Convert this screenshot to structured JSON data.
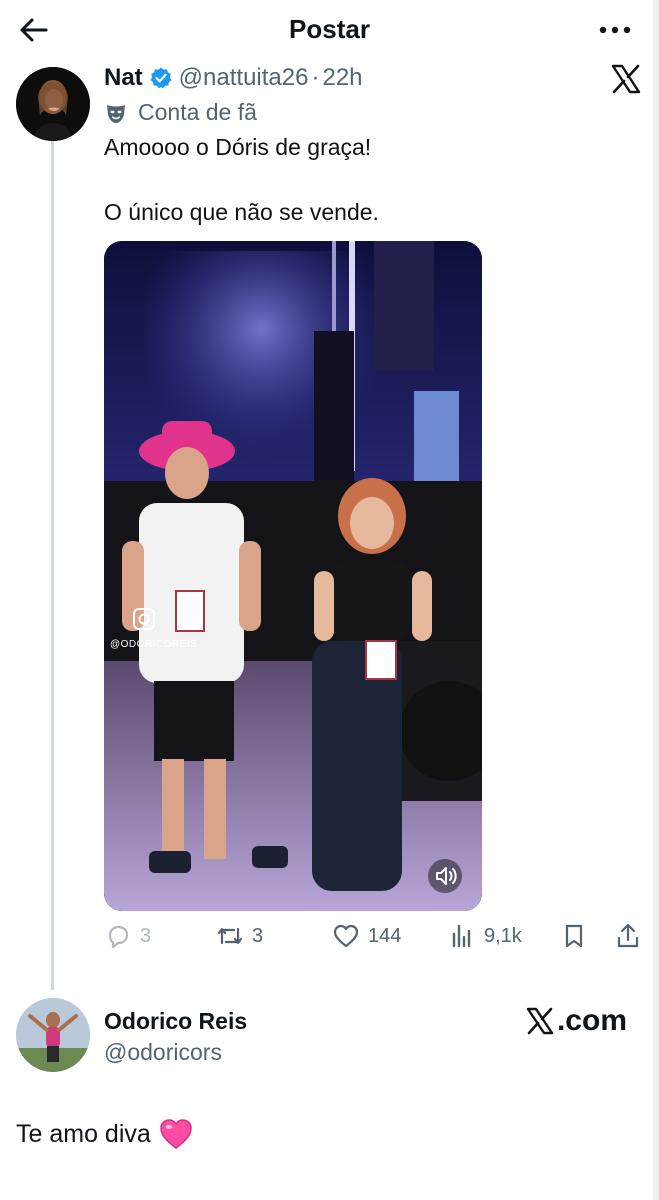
{
  "header": {
    "title": "Postar",
    "back_icon": "arrow-left-icon",
    "more_icon": "more-dots-icon"
  },
  "tweet": {
    "author_name": "Nat",
    "handle": "@nattuita26",
    "separator": "·",
    "time": "22h",
    "fan_badge": "Conta de fã",
    "text_line_1": "Amoooo o Dóris de graça!",
    "text_line_2": "O único que não se vende.",
    "media_watermark": "@ODORICOREIS",
    "actions": {
      "replies": "3",
      "retweets": "3",
      "likes": "144",
      "views": "9,1k"
    }
  },
  "reply": {
    "author_name": "Odorico Reis",
    "handle": "@odoricors",
    "source": ".com",
    "text": "Te amo diva"
  },
  "colors": {
    "text": "#0f1419",
    "muted": "#536471",
    "verified": "#1d9bf0",
    "thread_line": "#cfd9de",
    "heart": "#ff4da6"
  }
}
